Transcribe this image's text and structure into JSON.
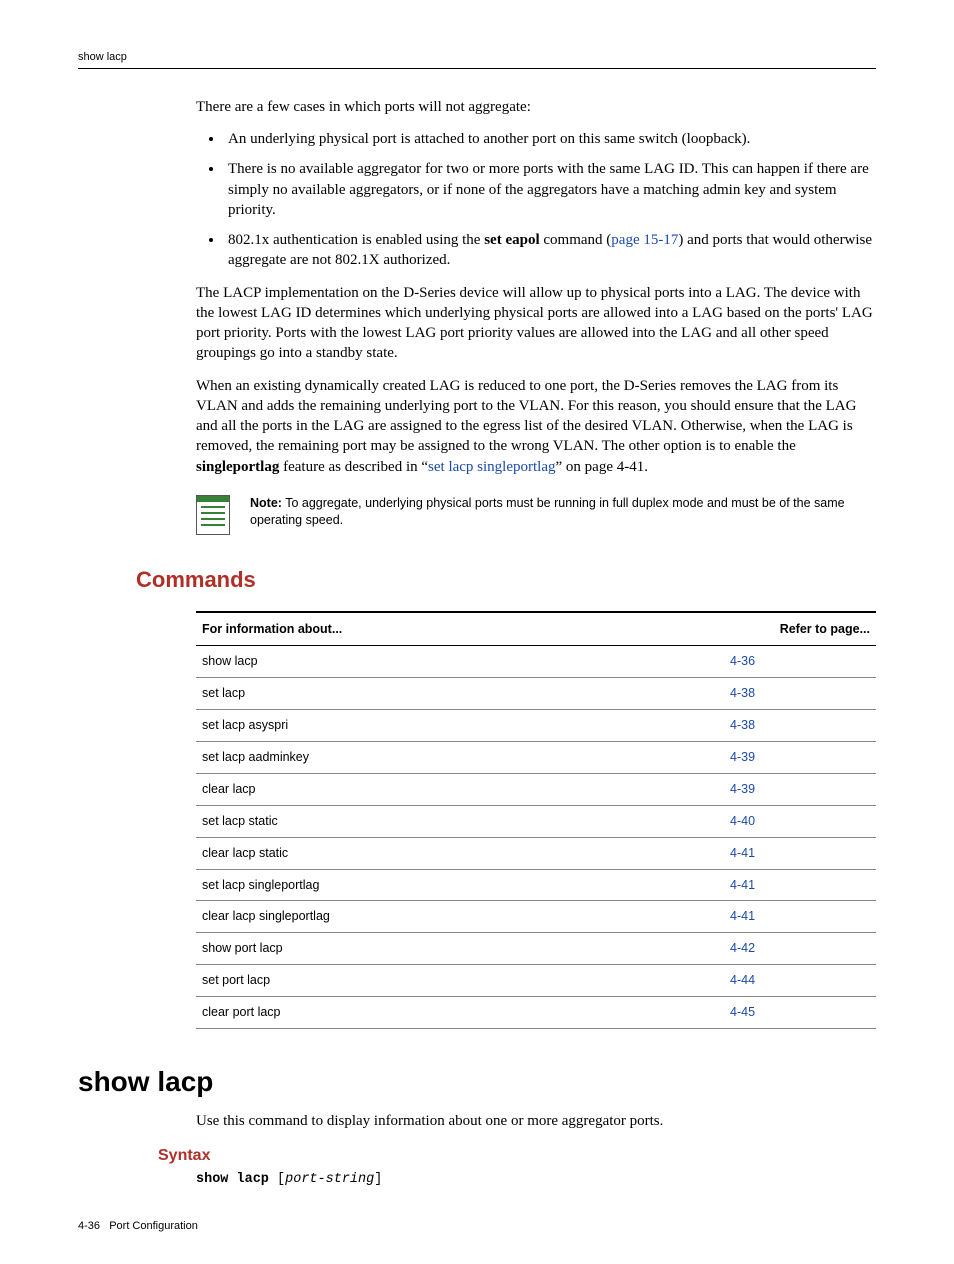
{
  "header": {
    "running": "show lacp"
  },
  "body": {
    "intro": "There are a few cases in which ports will not aggregate:",
    "bullets": [
      {
        "text": "An underlying physical port is attached to another port on this same switch (loopback)."
      },
      {
        "text": "There is no available aggregator for two or more ports with the same LAG ID. This can happen if there are simply no available aggregators, or if none of the aggregators have a matching admin key and system priority."
      },
      {
        "pre": "802.1x authentication is enabled using the ",
        "bold": "set eapol",
        "mid": " command (",
        "link": "page 15-17",
        "post": ") and ports that would otherwise aggregate are not 802.1X authorized."
      }
    ],
    "p2": "The LACP implementation on the D-Series device will allow up to physical ports into a LAG. The device with the lowest LAG ID determines which underlying physical ports are allowed into a LAG based on the ports' LAG port priority. Ports with the lowest LAG port priority values are allowed into the LAG and all other speed groupings go into a standby state.",
    "p3_pre": "When an existing dynamically created LAG is reduced to one port, the D-Series removes the LAG from its VLAN and adds the remaining underlying port to the VLAN. For this reason, you should ensure that the LAG and all the ports in the LAG are assigned to the egress list of the desired VLAN. Otherwise, when the LAG is removed, the remaining port may be assigned to the wrong VLAN. The other option is to enable the ",
    "p3_bold": "singleportlag",
    "p3_mid": " feature as described in “",
    "p3_link": "set lacp singleportlag",
    "p3_post": "” on page 4-41."
  },
  "note": {
    "label": "Note:",
    "text": " To aggregate, underlying physical ports must be running in full duplex mode and must be of the same operating speed."
  },
  "commands": {
    "heading": "Commands",
    "col1": "For information about...",
    "col2": "Refer to page...",
    "rows": [
      {
        "cmd": "show lacp",
        "page": "4-36"
      },
      {
        "cmd": "set lacp",
        "page": "4-38"
      },
      {
        "cmd": "set lacp asyspri",
        "page": "4-38"
      },
      {
        "cmd": "set lacp aadminkey",
        "page": "4-39"
      },
      {
        "cmd": "clear lacp",
        "page": "4-39"
      },
      {
        "cmd": "set lacp static",
        "page": "4-40"
      },
      {
        "cmd": "clear lacp static",
        "page": "4-41"
      },
      {
        "cmd": "set lacp singleportlag",
        "page": "4-41"
      },
      {
        "cmd": "clear lacp singleportlag",
        "page": "4-41"
      },
      {
        "cmd": "show port lacp",
        "page": "4-42"
      },
      {
        "cmd": "set port lacp",
        "page": "4-44"
      },
      {
        "cmd": "clear port lacp",
        "page": "4-45"
      }
    ]
  },
  "section": {
    "title": "show lacp",
    "desc": "Use this command to display information about one or more aggregator ports.",
    "syntax_h": "Syntax",
    "syntax_cmd": "show lacp",
    "syntax_arg": "port-string"
  },
  "footer": {
    "page": "4-36",
    "chapter": "Port Configuration"
  }
}
